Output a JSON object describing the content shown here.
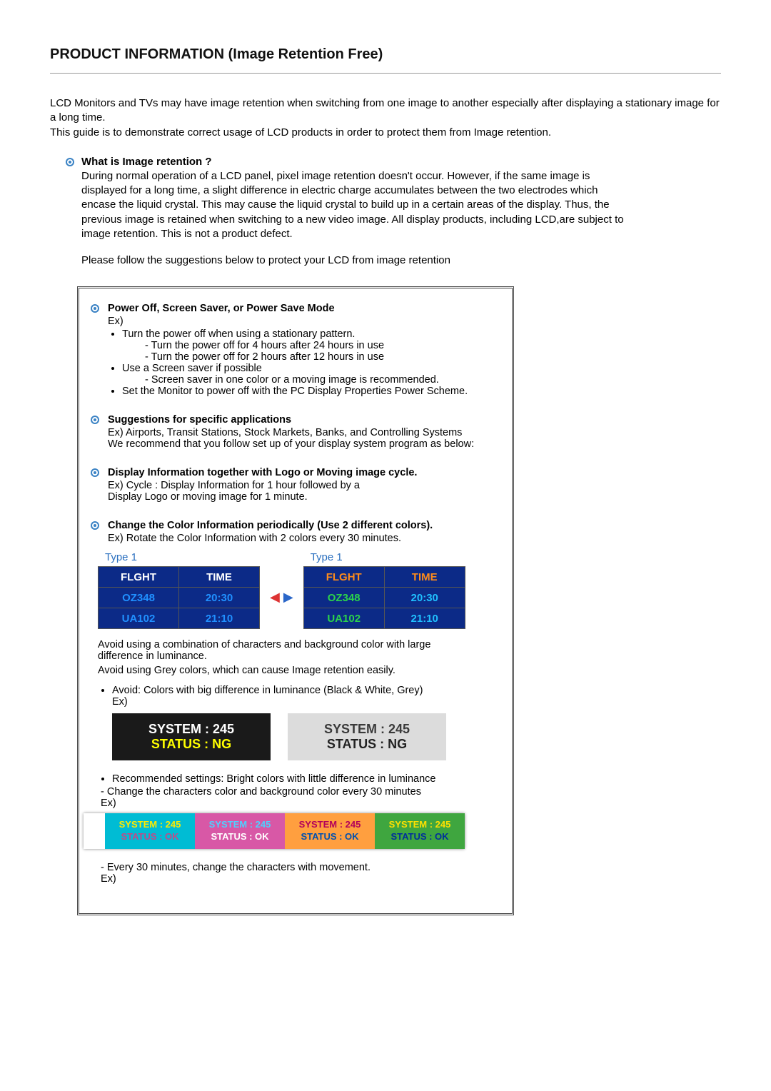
{
  "title": "PRODUCT INFORMATION (Image Retention Free)",
  "intro_line1": "LCD Monitors and TVs may have image retention when switching from one image to another especially after displaying a stationary image for a long time.",
  "intro_line2": "This guide is to demonstrate correct usage of LCD products in order to protect them from Image retention.",
  "s1": {
    "heading": "What is Image retention ?",
    "body": "During normal operation of a LCD panel, pixel image retention doesn't occur. However, if the same image is displayed for a long time, a slight difference in electric charge accumulates between the two electrodes which encase the liquid crystal. This may cause the liquid crystal to build up in a certain areas of the display. Thus, the previous image is retained when switching to a new video image. All display products, including LCD,are subject to image retention. This is not a product defect."
  },
  "follow": "Please follow the suggestions below to protect your LCD from image retention",
  "box": {
    "s2": {
      "heading": "Power Off, Screen Saver, or Power Save Mode",
      "ex": "Ex)",
      "b1": "Turn the power off when using a stationary pattern.",
      "b1a": "- Turn the power off for 4 hours after 24 hours in use",
      "b1b": "- Turn the power off for 2 hours after 12 hours in use",
      "b2": "Use a Screen saver if possible",
      "b2a": "- Screen saver in one color or a moving image is recommended.",
      "b3": "Set the Monitor to power off with the PC Display Properties Power Scheme."
    },
    "s3": {
      "heading": "Suggestions for specific applications",
      "l1": "Ex) Airports, Transit Stations, Stock Markets, Banks, and Controlling Systems",
      "l2": "We recommend that you follow set up of your display system program as below:"
    },
    "s4": {
      "heading": "Display Information together with Logo or Moving image cycle.",
      "l1": "Ex) Cycle : Display Information for 1 hour followed by a",
      "l2": "Display Logo or moving image for 1 minute."
    },
    "s5": {
      "heading": "Change the Color Information periodically (Use 2 different colors).",
      "l1": "Ex) Rotate the Color Information with 2 colors every 30 minutes."
    },
    "flight": {
      "type_label": "Type 1",
      "h_flight": "FLGHT",
      "h_time": "TIME",
      "r1f": "OZ348",
      "r1t": "20:30",
      "r2f": "UA102",
      "r2t": "21:10"
    },
    "note1": "Avoid using a combination of characters and background color with large difference in luminance.",
    "note2": "Avoid using Grey colors, which can cause Image retention easily.",
    "avoid_bullet": "Avoid: Colors with big difference in luminance (Black & White, Grey)",
    "avoid_ex": "Ex)",
    "sys": {
      "l1": "SYSTEM : 245",
      "l2": "STATUS : NG"
    },
    "rec_bullet": "Recommended settings: Bright colors with little difference in luminance",
    "rec_l1": "- Change the characters color and background color every 30 minutes",
    "rec_ex": "Ex)",
    "sys_ok": {
      "l1": "SYSTEM : 245",
      "l2": "STATUS : OK"
    },
    "move_l1": "- Every 30 minutes, change the characters with movement.",
    "move_ex": "Ex)"
  }
}
